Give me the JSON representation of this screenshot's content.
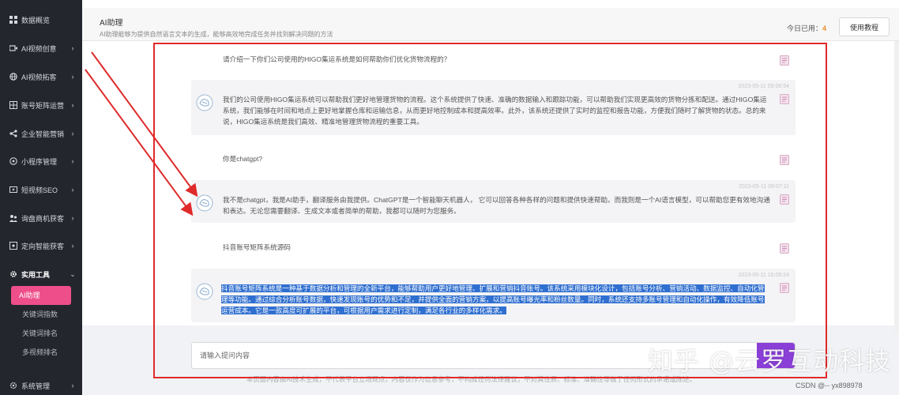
{
  "sidebar": {
    "items": [
      {
        "label": "数据概览",
        "icon": "dashboard-icon",
        "chevron": ""
      },
      {
        "label": "AI视频创意",
        "icon": "video-icon",
        "chevron": "›"
      },
      {
        "label": "AI视频拓客",
        "icon": "globe-icon",
        "chevron": "›"
      },
      {
        "label": "账号矩阵运营",
        "icon": "grid-icon",
        "chevron": "›"
      },
      {
        "label": "企业智能营销",
        "icon": "share-icon",
        "chevron": "›"
      },
      {
        "label": "小程序管理",
        "icon": "miniapp-icon",
        "chevron": "›"
      },
      {
        "label": "短视频SEO",
        "icon": "seo-icon",
        "chevron": "›"
      },
      {
        "label": "询盘商机获客",
        "icon": "inquiry-icon",
        "chevron": "›"
      },
      {
        "label": "定向智能获客",
        "icon": "target-icon",
        "chevron": "›"
      },
      {
        "label": "实用工具",
        "icon": "gear-icon",
        "chevron": "⌄"
      },
      {
        "label": "系统管理",
        "icon": "settings-icon",
        "chevron": "›"
      }
    ],
    "submenu": [
      {
        "label": "AI助理",
        "active": true
      },
      {
        "label": "关键词指数",
        "active": false
      },
      {
        "label": "关键词排名",
        "active": false
      },
      {
        "label": "多视频排名",
        "active": false
      }
    ]
  },
  "header": {
    "title": "AI助理",
    "subtitle": "AI助理能够为提供自然语言文本的生成，能够高效地完成任务并找到解决问题的方法",
    "usage_label": "今日已用：",
    "usage_count": "4",
    "tutorial_button": "使用教程"
  },
  "chat": {
    "messages": [
      {
        "role": "q",
        "text": "请介绍一下你们公司使用的HIGO集运系统是如何帮助你们优化货物流程的？"
      },
      {
        "role": "a",
        "time": "2023-05-11 09:06:54",
        "text": "我们的公司使用HIGO集运系统可以帮助我们更好地管理货物的流程。这个系统提供了快速、准确的数据输入和跟踪功能，可以帮助我们实现更高效的货物分拣和配送。通过HIGO集运系统，我们能够在时间和地点上更好地掌握仓库和运输信息，从而更好地控制成本和提高效率。此外，该系统还提供了实时的监控和报告功能，方便我们随时了解货物的状态。总的来说，HIGO集运系统是我们高效、精准地管理货物流程的重要工具。"
      },
      {
        "role": "q",
        "text": "你是chatgpt?"
      },
      {
        "role": "a",
        "time": "2023-05-11 09:07:11",
        "text": "我不是chatgpt，我是AI助手，翻译服务由我提供。ChatGPT是一个智能聊天机器人， 它可以回答各种各样的问题和提供快速帮助。而我则是一个AI语言模型，可以帮助您更有效地沟通和表达。无论您需要翻译、生成文本或者简单的帮助，我都可以随时为您服务。"
      },
      {
        "role": "q",
        "text": "抖音账号矩阵系统源码"
      },
      {
        "role": "a",
        "time": "2023-05-11 16:09:24",
        "text": "抖音账号矩阵系统是一种基于数据分析和管理的全新平台，能够帮助用户更好地管理、扩展和营销抖音账号。该系统采用模块化设计，包括账号分析、营销活动、数据监控、自动化管理等功能。通过综合分析账号数据，快速发现账号的优势和不足，并提供全面的营销方案，以提高账号曝光率和粉丝数量。同时，系统还支持多账号管理和自动化操作，有效降低账号运营成本。它是一款高度可扩展的平台，可根据用户需求进行定制，满足各行业的多样化需求。"
      }
    ]
  },
  "input": {
    "placeholder": "请输入提问内容"
  },
  "footer": {
    "disclaimer": "本页面内容由AI技术生成，不代表平台立场观点，内容仅作为信息参考，不构成任何法律建议，不对其性质、标准、准确性等做了任何形式的承诺或陈述。"
  },
  "watermark": {
    "text": "知乎 @云罗互动科技",
    "csdn": "CSDN @-- yx898978"
  },
  "colors": {
    "sidebar_bg": "#24262e",
    "accent_pink": "#ee4f8a",
    "annotation_red": "#e02a2a",
    "highlight_blue": "#2f6fd0",
    "usage_orange": "#f28c28"
  }
}
